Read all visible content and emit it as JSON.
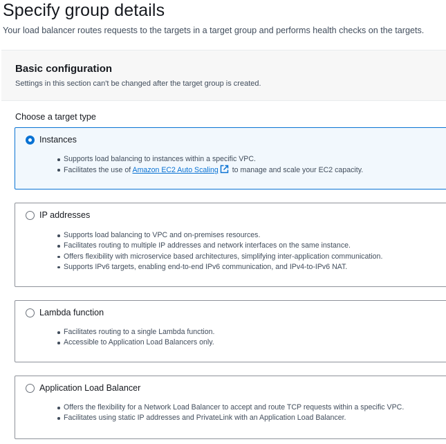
{
  "page": {
    "title": "Specify group details",
    "description": "Your load balancer routes requests to the targets in a target group and performs health checks on the targets."
  },
  "basic_config": {
    "title": "Basic configuration",
    "description": "Settings in this section can't be changed after the target group is created."
  },
  "target_type": {
    "label": "Choose a target type",
    "selected": "Instances",
    "options": [
      {
        "label": "Instances",
        "checked": true,
        "bullets": [
          "Supports load balancing to instances within a specific VPC."
        ],
        "link_bullet": {
          "prefix": "Facilitates the use of ",
          "link_text": "Amazon EC2 Auto Scaling",
          "link_icon": "external-link-icon",
          "suffix": " to manage and scale your EC2 capacity."
        }
      },
      {
        "label": "IP addresses",
        "checked": false,
        "bullets": [
          "Supports load balancing to VPC and on-premises resources.",
          "Facilitates routing to multiple IP addresses and network interfaces on the same instance.",
          "Offers flexibility with microservice based architectures, simplifying inter-application communication.",
          "Supports IPv6 targets, enabling end-to-end IPv6 communication, and IPv4-to-IPv6 NAT."
        ]
      },
      {
        "label": "Lambda function",
        "checked": false,
        "bullets": [
          "Facilitates routing to a single Lambda function.",
          "Accessible to Application Load Balancers only."
        ]
      },
      {
        "label": "Application Load Balancer",
        "checked": false,
        "bullets": [
          "Offers the flexibility for a Network Load Balancer to accept and route TCP requests within a specific VPC.",
          "Facilitates using static IP addresses and PrivateLink with an Application Load Balancer."
        ]
      }
    ]
  },
  "colors": {
    "accent": "#0972d3",
    "selected_tile_bg": "#f2f8fd",
    "tile_border": "#8d9199",
    "section_header_bg": "#f7f7f7",
    "body_text": "#16191f",
    "secondary_text": "#414d5c"
  }
}
